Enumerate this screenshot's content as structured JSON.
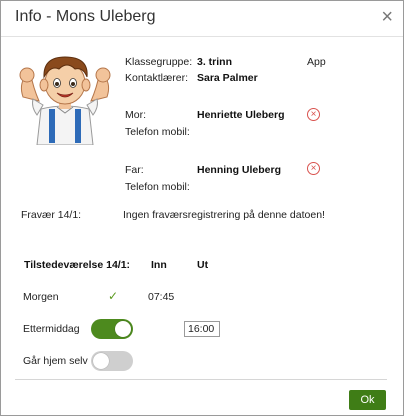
{
  "dialog": {
    "title": "Info - Mons Uleberg",
    "close_glyph": "×"
  },
  "student": {
    "class_label": "Klassegruppe:",
    "class_value": "3. trinn",
    "app_label": "App",
    "teacher_label": "Kontaktlærer:",
    "teacher_value": "Sara Palmer"
  },
  "mother": {
    "label": "Mor:",
    "name": "Henriette Uleberg",
    "phone_label": "Telefon mobil:",
    "remove_icon": "remove-circle-icon"
  },
  "father": {
    "label": "Far:",
    "name": "Henning Uleberg",
    "phone_label": "Telefon mobil:",
    "remove_icon": "remove-circle-icon"
  },
  "absence": {
    "label": "Fravær 14/1:",
    "text": "Ingen fraværsregistrering på denne datoen!"
  },
  "attendance": {
    "header": "Tilstedeværelse 14/1:",
    "in_label": "Inn",
    "out_label": "Ut",
    "morning": {
      "label": "Morgen",
      "check": "✓",
      "in_time": "07:45"
    },
    "afternoon": {
      "label": "Ettermiddag",
      "toggle_on": true,
      "out_time": "16:00"
    },
    "walks_home": {
      "label": "Går hjem selv",
      "toggle_on": false
    }
  },
  "footer": {
    "ok_label": "Ok"
  },
  "colors": {
    "accent": "#4d8a1e",
    "ok_button": "#3f7d16",
    "remove_icon": "#d9534f",
    "check": "#5b9a1f"
  }
}
